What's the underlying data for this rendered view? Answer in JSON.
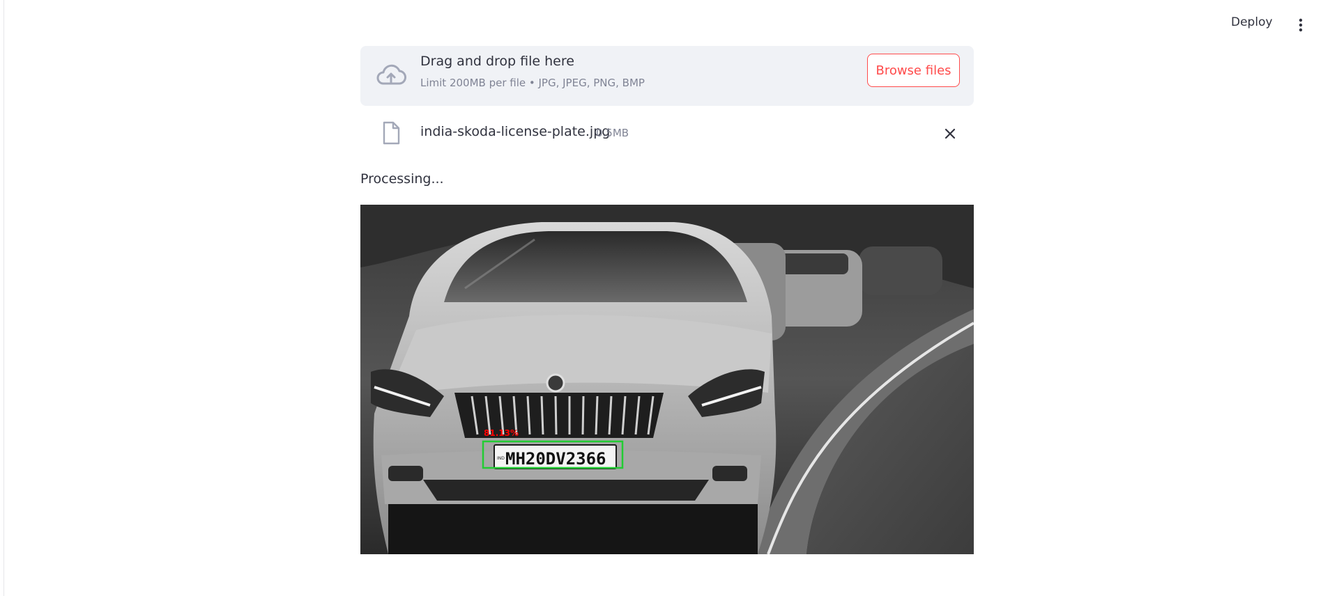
{
  "header": {
    "deploy_label": "Deploy",
    "menu_icon": "more-vertical-icon"
  },
  "uploader": {
    "dropzone_title": "Drag and drop file here",
    "dropzone_subtitle": "Limit 200MB per file • JPG, JPEG, PNG, BMP",
    "browse_label": "Browse files",
    "upload_icon": "cloud-upload-icon",
    "accent_color": "#ff4b4b"
  },
  "uploaded_file": {
    "name": "india-skoda-license-plate.jpg",
    "size": "0.5MB",
    "file_icon": "file-icon",
    "remove_icon": "close-icon"
  },
  "status": {
    "text": "Processing..."
  },
  "result_image": {
    "plate_text": "MH20DV2366",
    "plate_prefix": "IND",
    "confidence_label": "81.13%",
    "box_color": "#22cc33",
    "label_color": "#ff0000"
  }
}
